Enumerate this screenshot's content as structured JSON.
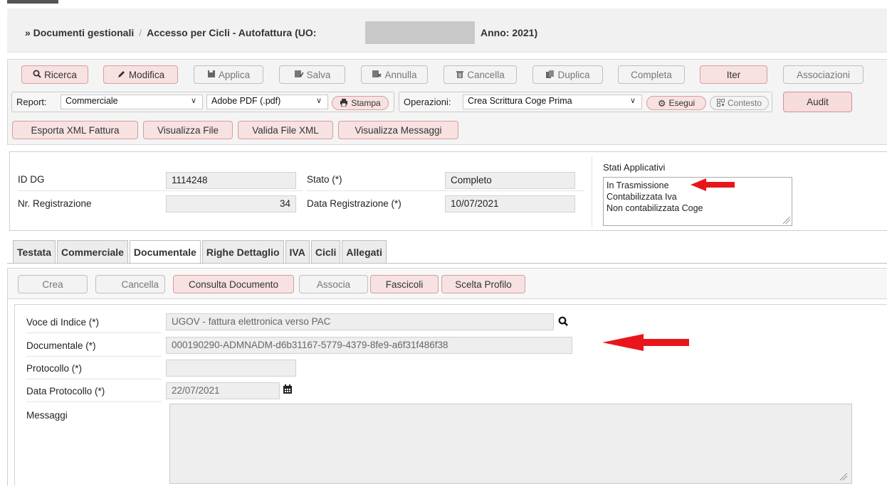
{
  "header": {
    "crumb_root": "» Documenti gestionali",
    "separator": "/",
    "crumb_current": "Accesso per Cicli - Autofattura (UO:",
    "year_text": "Anno: 2021)"
  },
  "toolbar": {
    "ricerca": "Ricerca",
    "modifica": "Modifica",
    "applica": "Applica",
    "salva": "Salva",
    "annulla": "Annulla",
    "cancella": "Cancella",
    "duplica": "Duplica",
    "completa": "Completa",
    "iter": "Iter",
    "associazioni": "Associazioni",
    "report_label": "Report:",
    "report_value": "Commerciale",
    "format_value": "Adobe PDF (.pdf)",
    "stampa": "Stampa",
    "operazioni_label": "Operazioni:",
    "operazioni_value": "Crea Scrittura Coge Prima",
    "esegui": "Esegui",
    "contesto": "Contesto",
    "audit": "Audit",
    "esporta_xml": "Esporta XML Fattura",
    "visualizza_file": "Visualizza File",
    "valida_xml": "Valida File XML",
    "visualizza_messaggi": "Visualizza Messaggi"
  },
  "info": {
    "id_dg_label": "ID DG",
    "id_dg_value": "1114248",
    "nr_reg_label": "Nr. Registrazione",
    "nr_reg_value": "34",
    "stato_label": "Stato (*)",
    "stato_value": "Completo",
    "data_reg_label": "Data Registrazione (*)",
    "data_reg_value": "10/07/2021",
    "stati_title": "Stati Applicativi",
    "stati_items": [
      "In Trasmissione",
      "Contabilizzata Iva",
      "Non contabilizzata Coge"
    ]
  },
  "tabs": [
    "Testata",
    "Commerciale",
    "Documentale",
    "Righe Dettaglio",
    "IVA",
    "Cicli",
    "Allegati"
  ],
  "active_tab": "Documentale",
  "doc_buttons": {
    "crea": "Crea",
    "cancella": "Cancella",
    "consulta": "Consulta Documento",
    "associa": "Associa",
    "fascicoli": "Fascicoli",
    "scelta_profilo": "Scelta Profilo"
  },
  "form": {
    "voce_label": "Voce di Indice (*)",
    "voce_value": "UGOV - fattura elettronica verso PAC",
    "documentale_label": "Documentale (*)",
    "documentale_value": "000190290-ADMNADM-d6b31167-5779-4379-8fe9-a6f31f486f38",
    "protocollo_label": "Protocollo (*)",
    "protocollo_value": "",
    "data_protocollo_label": "Data Protocollo (*)",
    "data_protocollo_value": "22/07/2021",
    "messaggi_label": "Messaggi",
    "messaggi_value": ""
  },
  "colors": {
    "accent_pink": "#f8e1e1",
    "annotation_red": "#e8161b"
  },
  "icons": {
    "ricerca": "search-icon",
    "modifica": "pencil-icon",
    "applica": "save-icon",
    "salva": "save-check-icon",
    "annulla": "undo-icon",
    "cancella": "trash-icon",
    "duplica": "copy-icon",
    "stampa": "print-icon",
    "esegui": "gear-icon",
    "contesto": "qr-icon",
    "voce_search": "search-icon",
    "calendar": "calendar-icon"
  }
}
